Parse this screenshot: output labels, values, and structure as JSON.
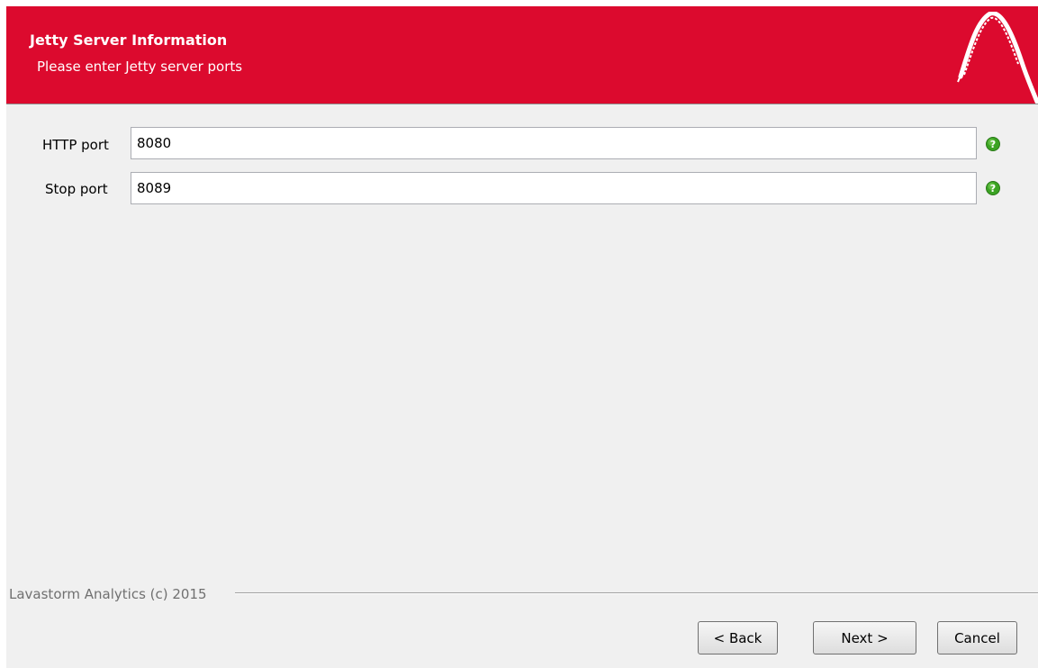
{
  "header": {
    "title": "Jetty Server Information",
    "subtitle": "Please enter Jetty server ports",
    "background": "#dc0a2e",
    "logo_icon": "lavastorm-arch-logo"
  },
  "form": {
    "fields": [
      {
        "label": "HTTP port",
        "value": "8080",
        "help_icon": "question-help-icon"
      },
      {
        "label": "Stop port",
        "value": "8089",
        "help_icon": "question-help-icon"
      }
    ]
  },
  "footer": {
    "copyright": "Lavastorm Analytics (c) 2015"
  },
  "buttons": {
    "back": "< Back",
    "next": "Next >",
    "cancel": "Cancel"
  }
}
